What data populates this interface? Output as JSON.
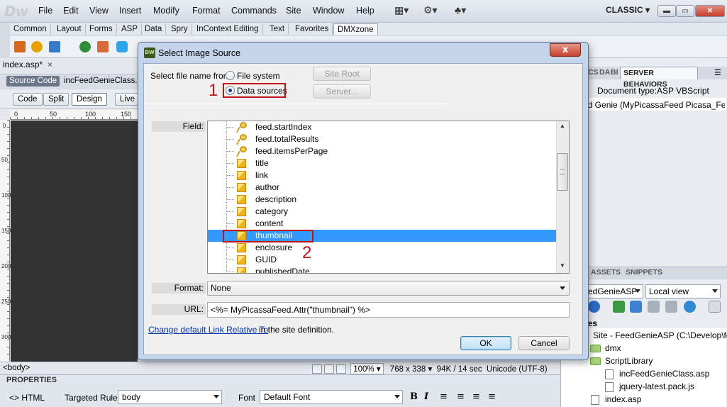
{
  "app": {
    "logo": "Dw",
    "menu": [
      "File",
      "Edit",
      "View",
      "Insert",
      "Modify",
      "Format",
      "Commands",
      "Site",
      "Window",
      "Help"
    ],
    "workspace": "CLASSIC"
  },
  "insert_tabs": [
    "Common",
    "Layout",
    "Forms",
    "ASP",
    "Data",
    "Spry",
    "InContext Editing",
    "Text",
    "Favorites",
    "DMXzone"
  ],
  "document": {
    "tab": "index.asp*",
    "close": "×",
    "source_code": "Source Code",
    "related_file": "incFeedGenieClass.asp",
    "views": [
      "Code",
      "Split",
      "Design",
      "Live"
    ],
    "ruler_h": [
      "0",
      "50",
      "100",
      "150"
    ],
    "ruler_v": [
      "0",
      "50",
      "100",
      "150",
      "200",
      "250",
      "300"
    ],
    "tag": "<body>",
    "zoom": "100%",
    "size": "768 x 338",
    "weight": "94K / 14 sec",
    "encoding": "Unicode (UTF-8)"
  },
  "properties": {
    "title": "PROPERTIES",
    "html": "<> HTML",
    "targeted_rule_label": "Targeted Rule",
    "targeted_rule": "body",
    "font_label": "Font",
    "font": "Default Font",
    "bold": "B",
    "italic": "I"
  },
  "right_panel": {
    "tabs_partial": [
      "CS",
      "DA",
      "BI"
    ],
    "server_behaviors": "SERVER BEHAVIORS",
    "doc_type": "Document type:ASP VBScript",
    "behavior_item": "ed Genie (MyPicassaFeed Picasa_Feat",
    "files_tabs": [
      "ASSETS",
      "SNIPPETS"
    ],
    "site_select": "edGenieASP",
    "view_select": "Local view",
    "files_header": "iles",
    "tree": [
      "Site - FeedGenieASP (C:\\Develop\\fee...",
      "dmx",
      "ScriptLibrary",
      "incFeedGenieClass.asp",
      "jquery-latest.pack.js",
      "index.asp"
    ]
  },
  "dialog": {
    "title": "Select Image Source",
    "close": "x",
    "select_from_label": "Select file name from:",
    "option_file_system": "File system",
    "option_data_sources": "Data sources",
    "selected_option": "Data sources",
    "site_root": "Site Root",
    "server": "Server...",
    "field_label": "Field:",
    "fields": [
      {
        "name": "feed.startIndex",
        "icon": "key"
      },
      {
        "name": "feed.totalResults",
        "icon": "key"
      },
      {
        "name": "feed.itemsPerPage",
        "icon": "key"
      },
      {
        "name": "title",
        "icon": "box"
      },
      {
        "name": "link",
        "icon": "box"
      },
      {
        "name": "author",
        "icon": "box"
      },
      {
        "name": "description",
        "icon": "box"
      },
      {
        "name": "category",
        "icon": "box"
      },
      {
        "name": "content",
        "icon": "box"
      },
      {
        "name": "thumbnail",
        "icon": "box"
      },
      {
        "name": "enclosure",
        "icon": "box"
      },
      {
        "name": "GUID",
        "icon": "box"
      },
      {
        "name": "publishedDate",
        "icon": "box"
      }
    ],
    "selected_field": "thumbnail",
    "format_label": "Format:",
    "format_value": "None",
    "url_label": "URL:",
    "url_value": "<%= MyPicassaFeed.Attr(\"thumbnail\") %>",
    "relative_link": "Change default Link Relative To",
    "relative_tail": "in the site definition.",
    "ok": "OK",
    "cancel": "Cancel"
  },
  "annotations": {
    "marker_1": "1",
    "marker_2": "2",
    "color": "#c0141a"
  }
}
